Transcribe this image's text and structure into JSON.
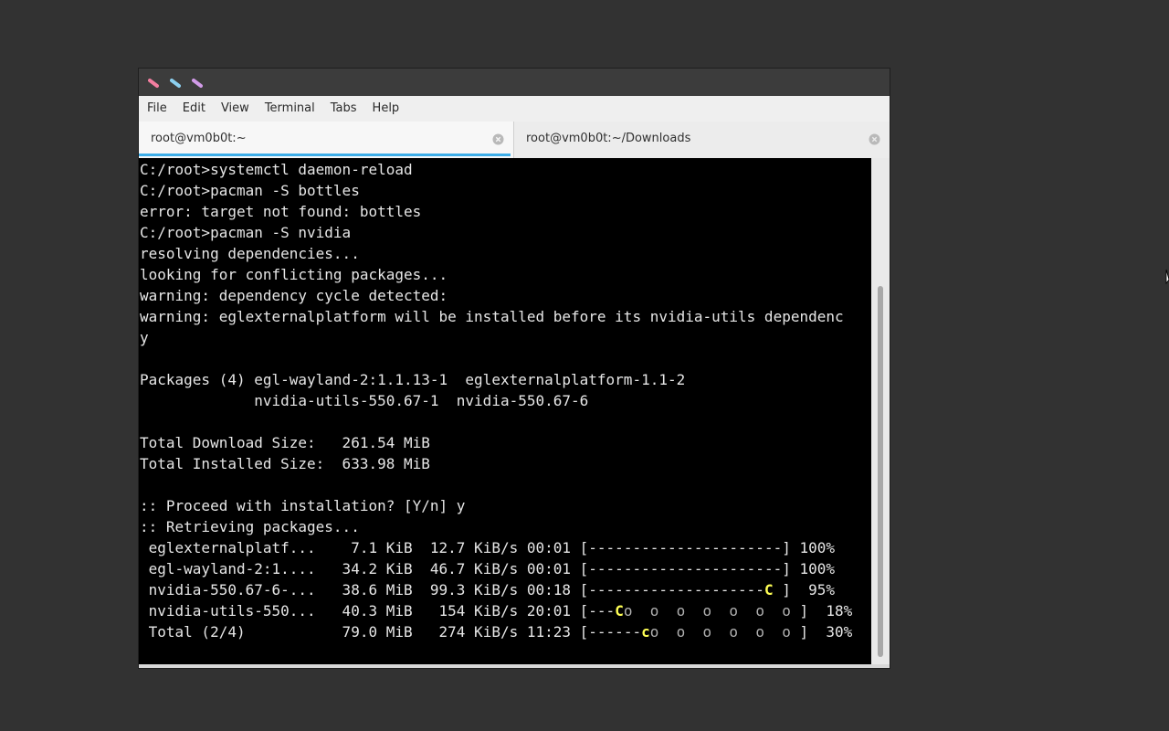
{
  "window": {
    "title_buttons": [
      {
        "name": "close-button",
        "color": "#f37ea0"
      },
      {
        "name": "minimize-button",
        "color": "#8cd0f0"
      },
      {
        "name": "maximize-button",
        "color": "#d19be8"
      }
    ]
  },
  "menu": {
    "items": [
      "File",
      "Edit",
      "View",
      "Terminal",
      "Tabs",
      "Help"
    ]
  },
  "tabs": [
    {
      "label": "root@vm0b0t:~",
      "active": true,
      "close_icon": "close-circle-icon"
    },
    {
      "label": "root@vm0b0t:~/Downloads",
      "active": false,
      "close_icon": "close-circle-icon"
    }
  ],
  "colors": {
    "accent": "#3daee9",
    "terminal_bg": "#000000",
    "terminal_fg": "#e6e6e6",
    "progress_highlight": "#ffff55"
  },
  "terminal": {
    "lines": [
      "C:/root>systemctl daemon-reload",
      "C:/root>pacman -S bottles",
      "error: target not found: bottles",
      "C:/root>pacman -S nvidia",
      "resolving dependencies...",
      "looking for conflicting packages...",
      "warning: dependency cycle detected:",
      "warning: eglexternalplatform will be installed before its nvidia-utils dependenc",
      "y",
      "",
      "Packages (4) egl-wayland-2:1.1.13-1  eglexternalplatform-1.1-2",
      "             nvidia-utils-550.67-1  nvidia-550.67-6",
      "",
      "Total Download Size:   261.54 MiB",
      "Total Installed Size:  633.98 MiB",
      "",
      ":: Proceed with installation? [Y/n] y",
      ":: Retrieving packages..."
    ],
    "downloads": [
      {
        "name": " eglexternalplatf...",
        "size": "    7.1 KiB",
        "rate": "  12.7 KiB/s",
        "time": " 00:01",
        "bar": [
          {
            "t": "----------------------",
            "c": ""
          }
        ],
        "percent": " 100%"
      },
      {
        "name": " egl-wayland-2:1....",
        "size": "   34.2 KiB",
        "rate": "  46.7 KiB/s",
        "time": " 00:01",
        "bar": [
          {
            "t": "----------------------",
            "c": ""
          }
        ],
        "percent": " 100%"
      },
      {
        "name": " nvidia-550.67-6-...",
        "size": "   38.6 MiB",
        "rate": "  99.3 KiB/s",
        "time": " 00:18",
        "bar": [
          {
            "t": "--------------------",
            "c": ""
          },
          {
            "t": "C",
            "c": "pac-c"
          },
          {
            "t": " ",
            "c": ""
          }
        ],
        "percent": "  95%"
      },
      {
        "name": " nvidia-utils-550...",
        "size": "   40.3 MiB",
        "rate": "   154 KiB/s",
        "time": " 20:01",
        "bar": [
          {
            "t": "---",
            "c": ""
          },
          {
            "t": "C",
            "c": "pac-c"
          },
          {
            "t": "o  o  o  o  o  o  o ",
            "c": "pac-o"
          }
        ],
        "percent": "  18%"
      },
      {
        "name": " Total (2/4)        ",
        "size": "   79.0 MiB",
        "rate": "   274 KiB/s",
        "time": " 11:23",
        "bar": [
          {
            "t": "------",
            "c": ""
          },
          {
            "t": "c",
            "c": "pac-c"
          },
          {
            "t": "o  o  o  o  o  o ",
            "c": "pac-o"
          }
        ],
        "percent": "  30%"
      }
    ]
  },
  "scrollbar": {
    "position_fraction": 0.26,
    "visible_fraction": 0.74
  }
}
